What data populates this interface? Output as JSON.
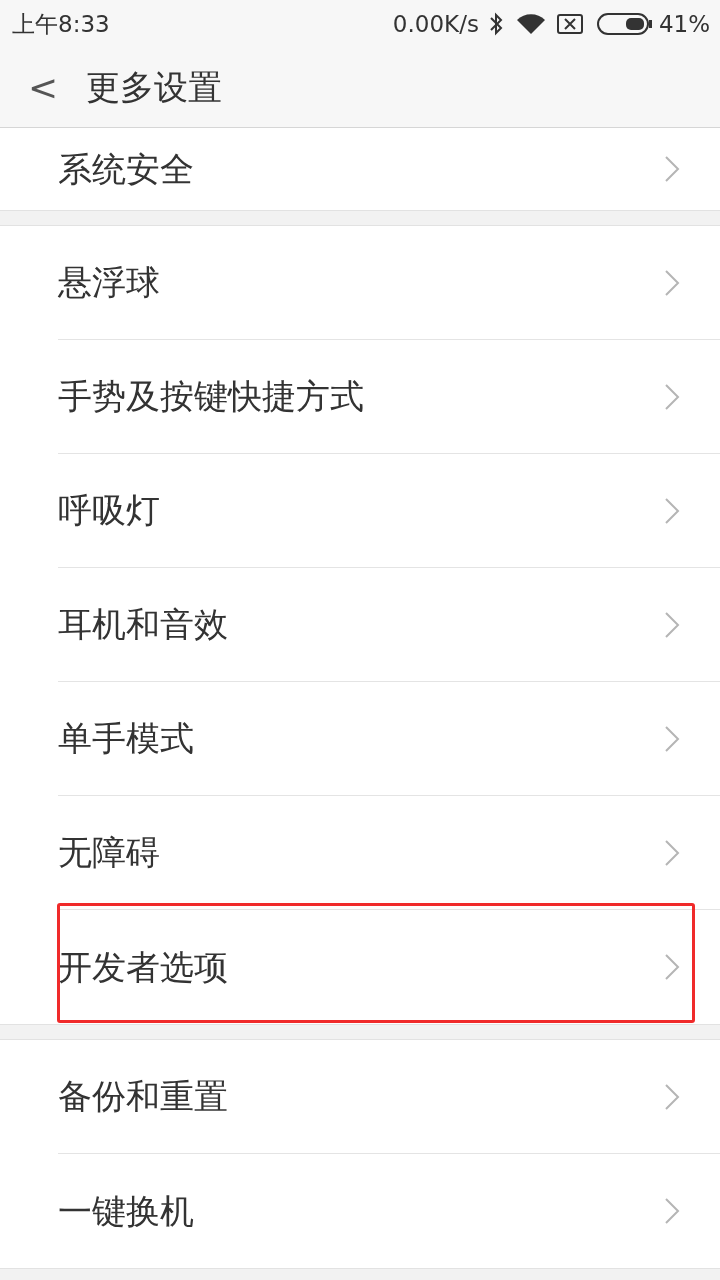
{
  "status_bar": {
    "time": "上午8:33",
    "speed": "0.00K/s",
    "battery": "41%"
  },
  "header": {
    "back": "<",
    "title": "更多设置"
  },
  "sections": [
    {
      "cut_top": true,
      "items": [
        {
          "label": "系统安全",
          "highlighted": false
        }
      ]
    },
    {
      "cut_top": false,
      "items": [
        {
          "label": "悬浮球",
          "highlighted": false
        },
        {
          "label": "手势及按键快捷方式",
          "highlighted": false
        },
        {
          "label": "呼吸灯",
          "highlighted": false
        },
        {
          "label": "耳机和音效",
          "highlighted": false
        },
        {
          "label": "单手模式",
          "highlighted": false
        },
        {
          "label": "无障碍",
          "highlighted": false
        },
        {
          "label": "开发者选项",
          "highlighted": true
        }
      ]
    },
    {
      "cut_top": false,
      "items": [
        {
          "label": "备份和重置",
          "highlighted": false
        },
        {
          "label": "一键换机",
          "highlighted": false
        }
      ]
    }
  ]
}
